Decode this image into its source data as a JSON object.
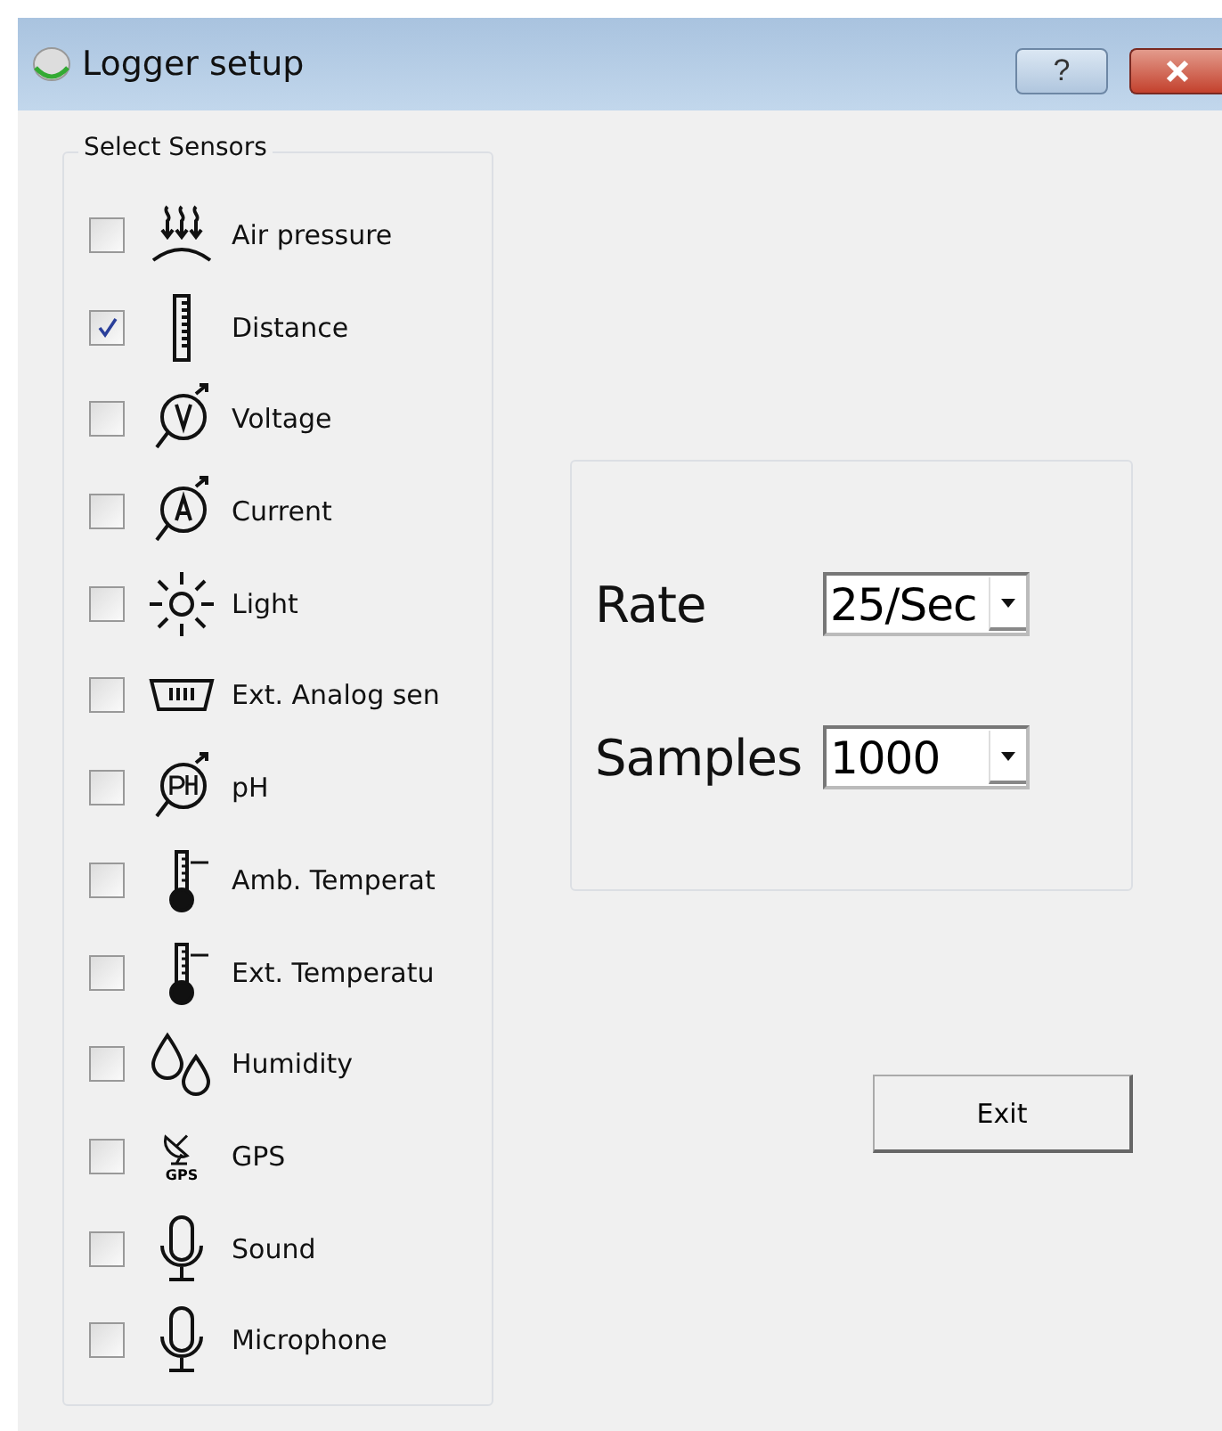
{
  "window": {
    "title": "Logger setup",
    "help_label": "?"
  },
  "sensors_group": {
    "title": "Select Sensors",
    "items": [
      {
        "label": "Air pressure",
        "kind": "pressure",
        "checked": false
      },
      {
        "label": "Distance",
        "kind": "ruler",
        "checked": true
      },
      {
        "label": "Voltage",
        "kind": "voltmeter",
        "checked": false
      },
      {
        "label": "Current",
        "kind": "ammeter",
        "checked": false
      },
      {
        "label": "Light",
        "kind": "sun",
        "checked": false
      },
      {
        "label": "Ext. Analog sen",
        "kind": "analog",
        "checked": false
      },
      {
        "label": "pH",
        "kind": "ph",
        "checked": false
      },
      {
        "label": "Amb. Temperat",
        "kind": "thermometer",
        "checked": false
      },
      {
        "label": "Ext. Temperatu",
        "kind": "thermometer",
        "checked": false
      },
      {
        "label": "Humidity",
        "kind": "drops",
        "checked": false
      },
      {
        "label": "GPS",
        "kind": "gps",
        "icon_text": "GPS",
        "checked": false
      },
      {
        "label": "Sound",
        "kind": "mic",
        "checked": false
      },
      {
        "label": "Microphone",
        "kind": "mic",
        "checked": false
      }
    ]
  },
  "settings": [
    {
      "label": "Rate",
      "value": "25/Sec"
    },
    {
      "label": "Samples",
      "value": "1000"
    }
  ],
  "buttons": [
    {
      "label": "Exit"
    }
  ]
}
